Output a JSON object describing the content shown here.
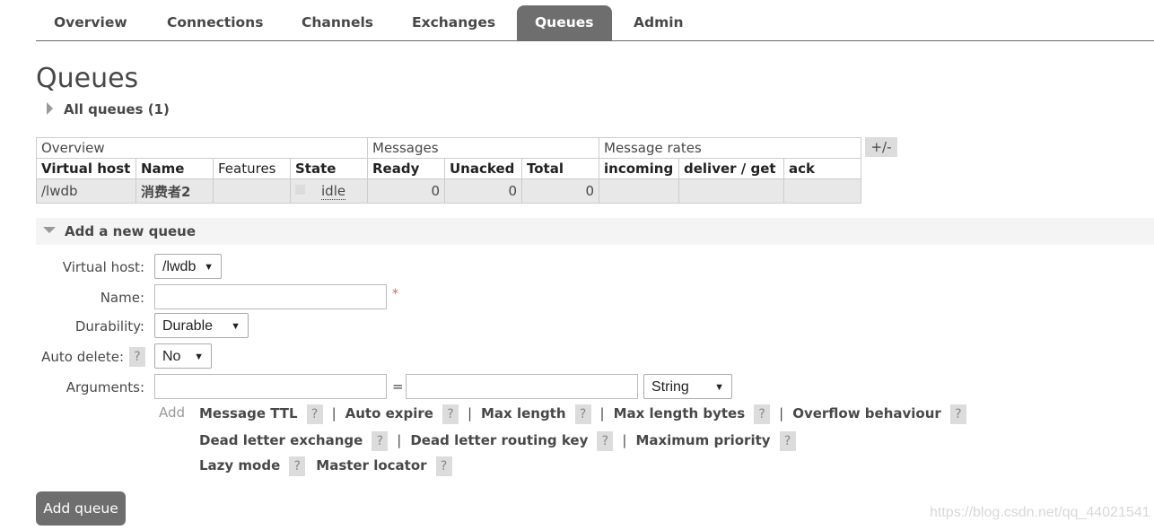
{
  "nav": {
    "tabs": [
      {
        "label": "Overview"
      },
      {
        "label": "Connections"
      },
      {
        "label": "Channels"
      },
      {
        "label": "Exchanges"
      },
      {
        "label": "Queues",
        "active": true
      },
      {
        "label": "Admin"
      }
    ]
  },
  "page": {
    "title": "Queues",
    "all_queues": "All queues (1)"
  },
  "table": {
    "groups": {
      "overview": "Overview",
      "messages": "Messages",
      "rates": "Message rates"
    },
    "columns": [
      "Virtual host",
      "Name",
      "Features",
      "State",
      "Ready",
      "Unacked",
      "Total",
      "incoming",
      "deliver / get",
      "ack"
    ],
    "rows": [
      {
        "vhost": "/lwdb",
        "name": "消费者2",
        "features": "",
        "state": "idle",
        "ready": "0",
        "unacked": "0",
        "total": "0",
        "incoming": "",
        "deliver_get": "",
        "ack": ""
      }
    ],
    "toggle": "+/-"
  },
  "add_queue": {
    "section_title": "Add a new queue",
    "virtual_host_label": "Virtual host:",
    "virtual_host_value": "/lwdb",
    "name_label": "Name:",
    "name_value": "",
    "required_mark": "*",
    "durability_label": "Durability:",
    "durability_value": "Durable",
    "auto_delete_label": "Auto delete:",
    "auto_delete_value": "No",
    "arguments_label": "Arguments:",
    "arg_key_value": "",
    "equals": "=",
    "arg_value_value": "",
    "arg_type_value": "String",
    "add_label": "Add",
    "help_mark": "?",
    "separator": "|",
    "arg_links_row1": [
      "Message TTL",
      "Auto expire",
      "Max length",
      "Max length bytes",
      "Overflow behaviour"
    ],
    "arg_links_row2": [
      "Dead letter exchange",
      "Dead letter routing key",
      "Maximum priority"
    ],
    "arg_links_row3": [
      "Lazy mode",
      "Master locator"
    ],
    "submit_label": "Add queue"
  },
  "watermark": "https://blog.csdn.net/qq_44021541",
  "colors": {
    "active_tab": "#6e6e6e",
    "row_bg": "#e8e8e8",
    "help_bg": "#dcdcdc",
    "required": "#e06060"
  }
}
